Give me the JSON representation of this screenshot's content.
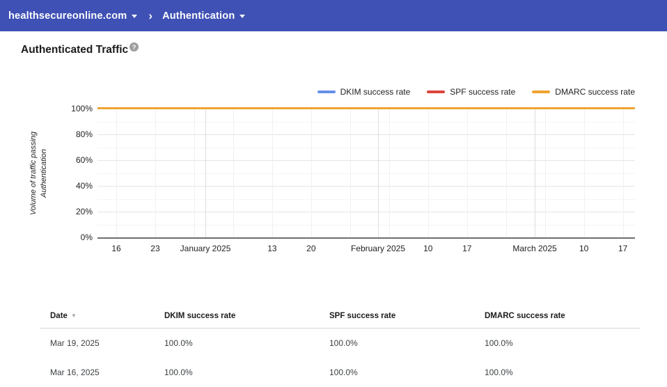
{
  "app_bar": {
    "domain": "healthsecureonline.com",
    "separator": "›",
    "page": "Authentication"
  },
  "page": {
    "title": "Authenticated Traffic",
    "help_glyph": "?"
  },
  "chart_data": {
    "type": "line",
    "title": "Authenticated Traffic",
    "ylabel": "Volume of traffic passing Authentication",
    "ylim": [
      0,
      100
    ],
    "y_unit": "%",
    "y_major_step": 20,
    "y_minor_step": 10,
    "y_tick_labels": [
      "0%",
      "20%",
      "40%",
      "60%",
      "80%",
      "100%"
    ],
    "grid": true,
    "legend_position": "top-right",
    "x_ticks": [
      {
        "label": "16",
        "pos": 0.035
      },
      {
        "label": "23",
        "pos": 0.1075
      },
      {
        "label": "January 2025",
        "pos": 0.2008
      },
      {
        "label": "13",
        "pos": 0.325
      },
      {
        "label": "20",
        "pos": 0.3975
      },
      {
        "label": "February 2025",
        "pos": 0.522
      },
      {
        "label": "10",
        "pos": 0.615
      },
      {
        "label": "17",
        "pos": 0.6875
      },
      {
        "label": "March 2025",
        "pos": 0.8135
      },
      {
        "label": "10",
        "pos": 0.905
      },
      {
        "label": "17",
        "pos": 0.9775
      }
    ],
    "x_gridlines_weekly": [
      0.035,
      0.1075,
      0.18,
      0.2525,
      0.325,
      0.3975,
      0.47,
      0.5425,
      0.615,
      0.6875,
      0.76,
      0.8325,
      0.905,
      0.9775
    ],
    "x_gridlines_month": [
      0.2008,
      0.522,
      0.8135
    ],
    "series": [
      {
        "name": "DKIM success rate",
        "color": "#6691e8",
        "constant_value_pct": 100
      },
      {
        "name": "SPF success rate",
        "color": "#db453c",
        "constant_value_pct": 100
      },
      {
        "name": "DMARC success rate",
        "color": "#f0a330",
        "constant_value_pct": 100
      }
    ]
  },
  "table": {
    "columns": [
      "Date",
      "DKIM success rate",
      "SPF success rate",
      "DMARC success rate"
    ],
    "sort_column": "Date",
    "sort_glyph": "▼",
    "rows": [
      [
        "Mar 19, 2025",
        "100.0%",
        "100.0%",
        "100.0%"
      ],
      [
        "Mar 16, 2025",
        "100.0%",
        "100.0%",
        "100.0%"
      ]
    ]
  }
}
